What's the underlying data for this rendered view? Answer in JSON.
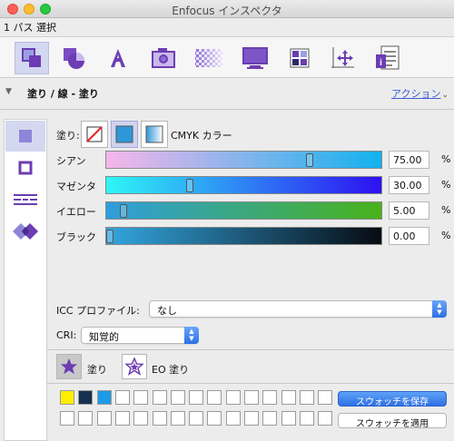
{
  "window": {
    "title": "Enfocus インスペクタ"
  },
  "selection": {
    "info": "1 パス 選択"
  },
  "toolbar": {
    "tools": [
      {
        "name": "fill-stroke-tool",
        "icon": "fill-stroke-icon",
        "active": true
      },
      {
        "name": "shape-tool",
        "icon": "shape-icon",
        "active": false
      },
      {
        "name": "text-tool",
        "icon": "text-icon",
        "active": false
      },
      {
        "name": "image-tool",
        "icon": "camera-icon",
        "active": false
      },
      {
        "name": "transparency-tool",
        "icon": "transparency-icon",
        "active": false
      },
      {
        "name": "monitor-tool",
        "icon": "monitor-icon",
        "active": false
      },
      {
        "name": "color-grid-tool",
        "icon": "color-grid-icon",
        "active": false
      },
      {
        "name": "position-tool",
        "icon": "move-axes-icon",
        "active": false
      },
      {
        "name": "document-tool",
        "icon": "document-list-icon",
        "active": false
      }
    ]
  },
  "section": {
    "title": "塗り / 線 - 塗り",
    "action_label": "アクション"
  },
  "sidetabs": [
    {
      "name": "fill-tab",
      "icon": "fill-square-icon",
      "active": true
    },
    {
      "name": "stroke-tab",
      "icon": "stroke-square-icon",
      "active": false
    },
    {
      "name": "line-style-tab",
      "icon": "line-style-icon",
      "active": false
    },
    {
      "name": "overprint-tab",
      "icon": "overprint-diamond-icon",
      "active": false
    }
  ],
  "fill": {
    "label": "塗り:",
    "type_buttons": [
      {
        "name": "no-fill-button",
        "icon": "no-fill-icon",
        "active": false
      },
      {
        "name": "solid-fill-button",
        "icon": "solid-fill-icon",
        "active": true
      },
      {
        "name": "gradient-fill-button",
        "icon": "gradient-fill-icon",
        "active": false
      }
    ],
    "mode_label": "CMYK カラー"
  },
  "cmyk": [
    {
      "key": "cyan",
      "label": "シアン",
      "value": "75.00",
      "level": 0.75,
      "unit": "%",
      "grad": [
        "#f7b6ea",
        "#12b2ee"
      ]
    },
    {
      "key": "magenta",
      "label": "マゼンタ",
      "value": "30.00",
      "level": 0.3,
      "unit": "%",
      "grad": [
        "#2ef6f6",
        "#2d10f2"
      ]
    },
    {
      "key": "yellow",
      "label": "イエロー",
      "value": "5.00",
      "level": 0.05,
      "unit": "%",
      "grad": [
        "#2f9ede",
        "#48b21a"
      ]
    },
    {
      "key": "black",
      "label": "ブラック",
      "value": "0.00",
      "level": 0.0,
      "unit": "%",
      "grad": [
        "#33a6df",
        "#070b12"
      ]
    }
  ],
  "icc": {
    "label": "ICC プロファイル:",
    "value": "なし"
  },
  "cri": {
    "label": "CRI:",
    "value": "知覚的"
  },
  "fillmodes": [
    {
      "name": "fill-mode-button",
      "label": "塗り",
      "active": true
    },
    {
      "name": "eo-fill-mode-button",
      "label": "EO 塗り",
      "active": false
    }
  ],
  "swatches": {
    "colors": [
      "#ffee00",
      "#18304f",
      "#1d9be6"
    ],
    "save_label": "スウォッチを保存",
    "apply_label": "スウォッチを適用"
  },
  "colors": {
    "accent": "#3b5bd3",
    "active_bg": "#d3d7f0",
    "icon_purple": "#6c3db3"
  }
}
